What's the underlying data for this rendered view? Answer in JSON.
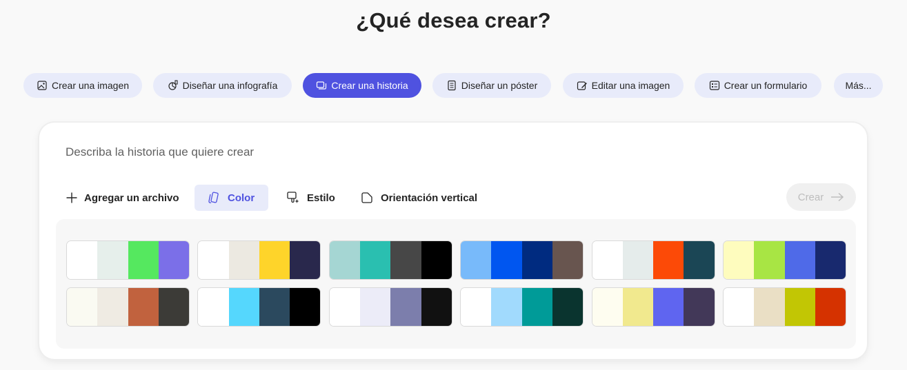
{
  "heading": "¿Qué desea crear?",
  "chips": [
    {
      "label": "Crear una imagen",
      "icon": "image-icon",
      "active": false
    },
    {
      "label": "Diseñar una infografía",
      "icon": "infographic-icon",
      "active": false
    },
    {
      "label": "Crear una historia",
      "icon": "story-icon",
      "active": true
    },
    {
      "label": "Diseñar un póster",
      "icon": "poster-icon",
      "active": false
    },
    {
      "label": "Editar una imagen",
      "icon": "edit-image-icon",
      "active": false
    },
    {
      "label": "Crear un formulario",
      "icon": "form-icon",
      "active": false
    },
    {
      "label": "Más...",
      "icon": "",
      "active": false
    }
  ],
  "prompt": {
    "placeholder": "Describa la historia que quiere crear",
    "value": ""
  },
  "toolbar": {
    "add_file": "Agregar un archivo",
    "color": "Color",
    "style": "Estilo",
    "orientation": "Orientación vertical",
    "create": "Crear"
  },
  "colors": {
    "accent": "#4f52e0",
    "chip_bg": "#e8ebfa"
  },
  "palettes": [
    [
      "#ffffff",
      "#e6efeb",
      "#55e85f",
      "#7b6fe8"
    ],
    [
      "#ffffff",
      "#ece9e1",
      "#fed42a",
      "#29284c"
    ],
    [
      "#a5d6d3",
      "#2abfb0",
      "#474747",
      "#000000"
    ],
    [
      "#78bafa",
      "#0056f0",
      "#002b80",
      "#68554f"
    ],
    [
      "#ffffff",
      "#e5eceb",
      "#fc4a07",
      "#1b4655"
    ],
    [
      "#fefcbe",
      "#a8e544",
      "#4f6ae8",
      "#18296e"
    ],
    [
      "#fafaf2",
      "#efebe3",
      "#c1623e",
      "#3c3b37"
    ],
    [
      "#ffffff",
      "#55d7fd",
      "#2b495e",
      "#000000"
    ],
    [
      "#ffffff",
      "#ececf8",
      "#7c7eac",
      "#111111"
    ],
    [
      "#ffffff",
      "#a1dafd",
      "#009b98",
      "#0a342f"
    ],
    [
      "#fefdf0",
      "#f1e98e",
      "#5f65f0",
      "#423858"
    ],
    [
      "#ffffff",
      "#eadfc5",
      "#c2c604",
      "#d53200"
    ]
  ]
}
